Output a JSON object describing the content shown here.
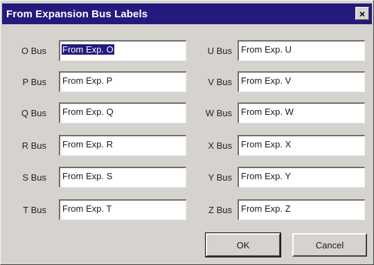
{
  "window": {
    "title": "From Expansion Bus Labels",
    "close_glyph": "×"
  },
  "left_fields": [
    {
      "label": "O Bus",
      "value": "From Exp. O",
      "selected": true
    },
    {
      "label": "P Bus",
      "value": "From Exp. P"
    },
    {
      "label": "Q Bus",
      "value": "From Exp. Q"
    },
    {
      "label": "R Bus",
      "value": "From Exp. R"
    },
    {
      "label": "S Bus",
      "value": "From Exp. S"
    },
    {
      "label": "T Bus",
      "value": "From Exp. T"
    }
  ],
  "right_fields": [
    {
      "label": "U Bus",
      "value": "From Exp. U"
    },
    {
      "label": "V Bus",
      "value": "From Exp. V"
    },
    {
      "label": "W Bus",
      "value": "From Exp. W"
    },
    {
      "label": "X Bus",
      "value": "From Exp. X"
    },
    {
      "label": "Y Bus",
      "value": "From Exp. Y"
    },
    {
      "label": "Z Bus",
      "value": "From Exp. Z"
    }
  ],
  "buttons": {
    "ok_label": "OK",
    "cancel_label": "Cancel"
  },
  "colors": {
    "titlebar": "#241a7e",
    "face": "#d6d3ce",
    "selection": "#241a7e"
  }
}
